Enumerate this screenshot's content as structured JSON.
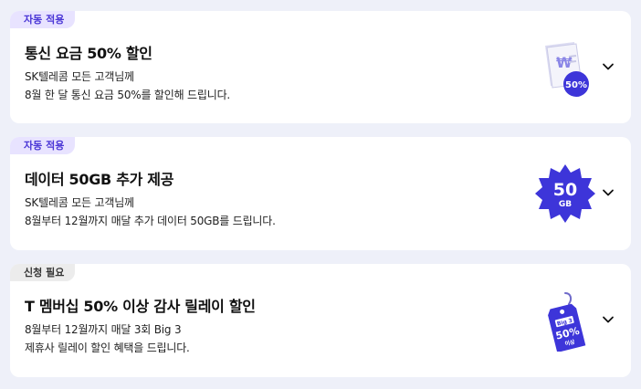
{
  "offers": [
    {
      "badge": "자동 적용",
      "title": "통신 요금 50% 할인",
      "desc_line1": "SK텔레콤 모든 고객님께",
      "desc_line2": "8월 한 달 통신 요금 50%를 할인해 드립니다.",
      "icon": "receipt-discount-icon",
      "icon_text": "50%"
    },
    {
      "badge": "자동 적용",
      "title": "데이터 50GB 추가 제공",
      "desc_line1": "SK텔레콤 모든 고객님께",
      "desc_line2": "8월부터 12월까지 매달 추가 데이터 50GB를 드립니다.",
      "icon": "data-burst-icon",
      "icon_text": "50",
      "icon_sub": "GB"
    },
    {
      "badge": "신청 필요",
      "title": "T 멤버십 50% 이상 감사 릴레이 할인",
      "desc_line1": "8월부터 12월까지 매달 3회 Big 3",
      "desc_line2": "제휴사 릴레이 할인 혜택을 드립니다.",
      "icon": "price-tag-icon",
      "icon_top": "Big 3",
      "icon_text": "50%",
      "icon_sub": "이상"
    }
  ],
  "colors": {
    "accent": "#3d35d9",
    "badge_auto_bg": "#e8e3ff",
    "badge_req_bg": "#ececec",
    "page_bg": "#eef0f9"
  }
}
